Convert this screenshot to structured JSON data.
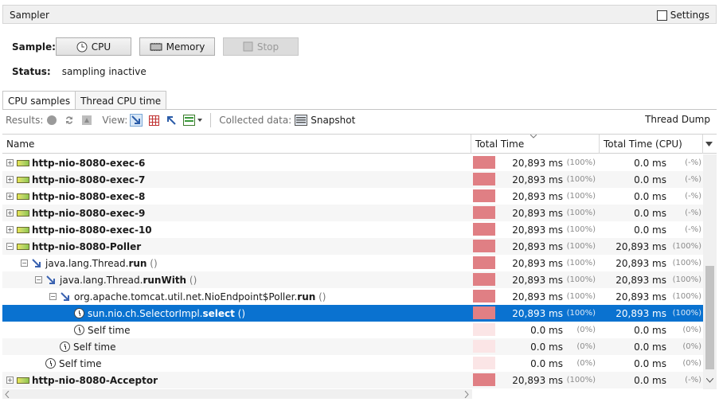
{
  "panel": {
    "title": "Sampler",
    "settings_label": "Settings"
  },
  "sample": {
    "label": "Sample:",
    "cpu_label": "CPU",
    "memory_label": "Memory",
    "stop_label": "Stop"
  },
  "status": {
    "label": "Status:",
    "value": "sampling inactive"
  },
  "tabs": [
    {
      "label": "CPU samples",
      "active": true
    },
    {
      "label": "Thread CPU time",
      "active": false
    }
  ],
  "toolbar": {
    "results_label": "Results:",
    "view_label": "View:",
    "collected_label": "Collected data:",
    "snapshot_label": "Snapshot",
    "thread_dump_label": "Thread Dump"
  },
  "table": {
    "columns": [
      "Name",
      "Total Time",
      "Total Time (CPU)"
    ],
    "rows": [
      {
        "indent": 0,
        "type": "thread",
        "name": "http-nio-8080-exec-6",
        "bold": true,
        "total": "20,893 ms",
        "total_pct": "(100%)",
        "bar": "full",
        "cpu": "0.0 ms",
        "cpu_pct": "(-%)"
      },
      {
        "indent": 0,
        "type": "thread",
        "name": "http-nio-8080-exec-7",
        "bold": true,
        "total": "20,893 ms",
        "total_pct": "(100%)",
        "bar": "full",
        "cpu": "0.0 ms",
        "cpu_pct": "(-%)"
      },
      {
        "indent": 0,
        "type": "thread",
        "name": "http-nio-8080-exec-8",
        "bold": true,
        "total": "20,893 ms",
        "total_pct": "(100%)",
        "bar": "full",
        "cpu": "0.0 ms",
        "cpu_pct": "(-%)"
      },
      {
        "indent": 0,
        "type": "thread",
        "name": "http-nio-8080-exec-9",
        "bold": true,
        "total": "20,893 ms",
        "total_pct": "(100%)",
        "bar": "full",
        "cpu": "0.0 ms",
        "cpu_pct": "(-%)"
      },
      {
        "indent": 0,
        "type": "thread",
        "name": "http-nio-8080-exec-10",
        "bold": true,
        "total": "20,893 ms",
        "total_pct": "(100%)",
        "bar": "full",
        "cpu": "0.0 ms",
        "cpu_pct": "(-%)"
      },
      {
        "indent": 0,
        "type": "thread",
        "name": "http-nio-8080-Poller",
        "bold": true,
        "expanded": true,
        "total": "20,893 ms",
        "total_pct": "(100%)",
        "bar": "full",
        "cpu": "20,893 ms",
        "cpu_pct": "(100%)"
      },
      {
        "indent": 1,
        "type": "method",
        "name_prefix": "java.lang.Thread.",
        "name_bold": "run",
        "name_suffix": " ()",
        "expanded": true,
        "total": "20,893 ms",
        "total_pct": "(100%)",
        "bar": "full",
        "cpu": "20,893 ms",
        "cpu_pct": "(100%)"
      },
      {
        "indent": 2,
        "type": "method",
        "name_prefix": "java.lang.Thread.",
        "name_bold": "runWith",
        "name_suffix": " ()",
        "expanded": true,
        "total": "20,893 ms",
        "total_pct": "(100%)",
        "bar": "full",
        "cpu": "20,893 ms",
        "cpu_pct": "(100%)"
      },
      {
        "indent": 3,
        "type": "method",
        "name_prefix": "org.apache.tomcat.util.net.NioEndpoint$Poller.",
        "name_bold": "run",
        "name_suffix": " ()",
        "expanded": true,
        "total": "20,893 ms",
        "total_pct": "(100%)",
        "bar": "full",
        "cpu": "20,893 ms",
        "cpu_pct": "(100%)"
      },
      {
        "indent": 4,
        "type": "clock",
        "name_prefix": "sun.nio.ch.SelectorImpl.",
        "name_bold": "select",
        "name_suffix": " ()",
        "selected": true,
        "total": "20,893 ms",
        "total_pct": "(100%)",
        "bar": "full",
        "cpu": "20,893 ms",
        "cpu_pct": "(100%)"
      },
      {
        "indent": 4,
        "type": "clock",
        "name": "Self time",
        "total": "0.0 ms",
        "total_pct": "(0%)",
        "bar": "pale",
        "cpu": "0.0 ms",
        "cpu_pct": "(0%)"
      },
      {
        "indent": 3,
        "type": "clock",
        "name": "Self time",
        "total": "0.0 ms",
        "total_pct": "(0%)",
        "bar": "pale",
        "cpu": "0.0 ms",
        "cpu_pct": "(0%)"
      },
      {
        "indent": 2,
        "type": "clock",
        "name": "Self time",
        "total": "0.0 ms",
        "total_pct": "(0%)",
        "bar": "pale",
        "cpu": "0.0 ms",
        "cpu_pct": "(0%)"
      },
      {
        "indent": 0,
        "type": "thread",
        "name": "http-nio-8080-Acceptor",
        "bold": true,
        "total": "20,893 ms",
        "total_pct": "(100%)",
        "bar": "full",
        "cpu": "0.0 ms",
        "cpu_pct": "(-%)"
      }
    ]
  },
  "colors": {
    "selection": "#0a72d0",
    "bar": "#e07f84",
    "bar_pale": "#fbe5e6"
  },
  "icons": [
    "clock-icon",
    "memory-chip-icon",
    "stop-icon",
    "gc-icon",
    "refresh-icon",
    "heap-dump-icon",
    "call-tree-icon",
    "hot-spots-icon",
    "combined-icon",
    "snapshot-icon",
    "thread-icon",
    "method-icon"
  ]
}
